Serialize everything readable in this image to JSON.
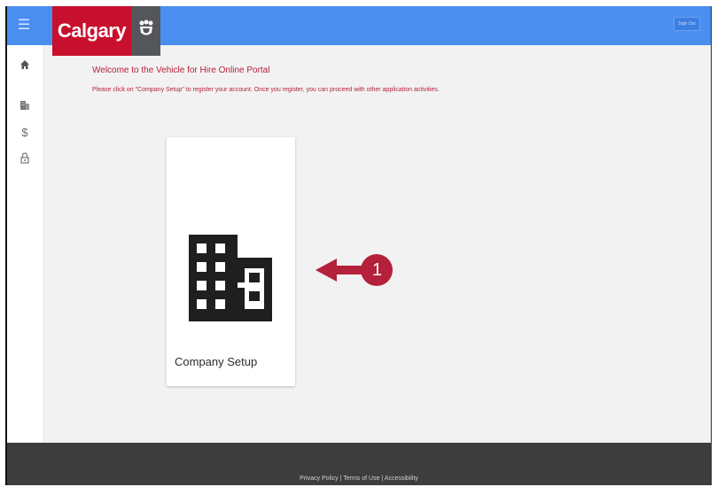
{
  "header": {
    "menu_icon": "hamburger-menu-icon",
    "logo_text": "Calgary",
    "signout_label": "Sign Out",
    "bar_color": "#4a8ef0",
    "brand_red": "#c8102e"
  },
  "sidebar": {
    "items": [
      {
        "name": "home-icon"
      },
      {
        "name": "building-icon"
      },
      {
        "name": "dollar-icon"
      },
      {
        "name": "lock-icon"
      }
    ]
  },
  "main": {
    "welcome_title": "Welcome to the Vehicle for Hire Online Portal",
    "instruction": "Please click on \"Company Setup\" to register your account. Once you register, you can proceed with other application activities.",
    "card": {
      "label": "Company Setup",
      "icon": "building-icon"
    },
    "callout": {
      "number": "1",
      "icon": "arrow-left-icon",
      "color": "#b5213a"
    }
  },
  "footer": {
    "links": "Privacy Policy | Terms of Use | Accessibility"
  }
}
